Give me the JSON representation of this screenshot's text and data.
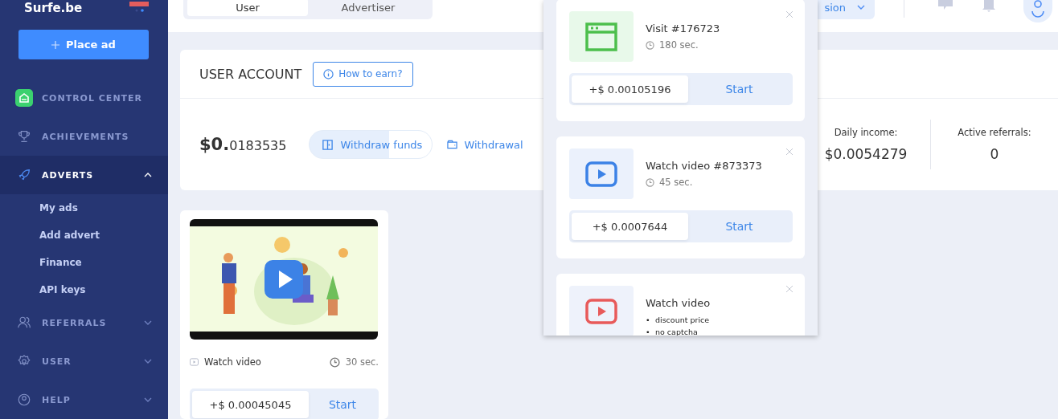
{
  "logo": {
    "text": "Surfe.be"
  },
  "top_tabs": [
    {
      "label": "User",
      "selected": true
    },
    {
      "label": "Advertiser",
      "selected": false
    }
  ],
  "top_dropdown": {
    "label": "sion"
  },
  "place_ad": {
    "label": "Place ad"
  },
  "nav": [
    {
      "kind": "home",
      "label": "CONTROL CENTER",
      "active": false
    },
    {
      "kind": "trophy",
      "label": "ACHIEVEMENTS",
      "active": false
    },
    {
      "kind": "rocket",
      "label": "ADVERTS",
      "active": true,
      "expanded": true,
      "children": [
        {
          "label": "My ads"
        },
        {
          "label": "Add advert"
        },
        {
          "label": "Finance"
        },
        {
          "label": "API keys"
        }
      ]
    },
    {
      "kind": "people",
      "label": "REFERRALS",
      "active": false,
      "expanded": false
    },
    {
      "kind": "gear",
      "label": "USER",
      "active": false,
      "expanded": false
    },
    {
      "kind": "help",
      "label": "HELP",
      "active": false,
      "expanded": false
    }
  ],
  "account": {
    "title": "USER ACCOUNT",
    "how_to_earn": "How to earn?",
    "balance_main": "$0.",
    "balance_fraction": "0183535",
    "withdraw": "Withdraw funds",
    "history": "Withdrawal",
    "stats": [
      {
        "label": "Daily income:",
        "value": "$0.0054279"
      },
      {
        "label": "Active referrals:",
        "value": "0"
      }
    ]
  },
  "ad_card": {
    "type": "Watch video",
    "duration": "30 sec.",
    "reward": "+$ 0.00045045",
    "action": "Start"
  },
  "popup_tasks": [
    {
      "kind": "visit",
      "title": "Visit #176723",
      "duration": "180 sec.",
      "reward": "+$ 0.00105196",
      "action": "Start"
    },
    {
      "kind": "video",
      "title": "Watch video #873373",
      "duration": "45 sec.",
      "reward": "+$ 0.0007644",
      "action": "Start"
    },
    {
      "kind": "video_red",
      "title": "Watch video",
      "bullets": [
        {
          "marker": "•",
          "text": "discount price"
        },
        {
          "marker": "•",
          "text": "no captcha"
        }
      ]
    }
  ]
}
